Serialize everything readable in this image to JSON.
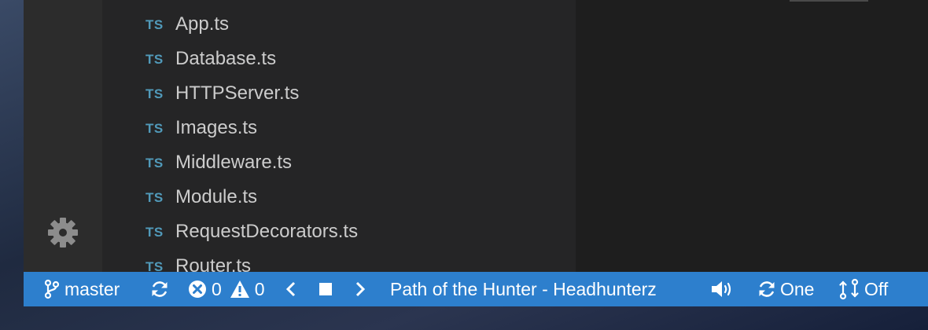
{
  "explorer": {
    "files": [
      {
        "badge": "TS",
        "name": "App.ts"
      },
      {
        "badge": "TS",
        "name": "Database.ts"
      },
      {
        "badge": "TS",
        "name": "HTTPServer.ts"
      },
      {
        "badge": "TS",
        "name": "Images.ts"
      },
      {
        "badge": "TS",
        "name": "Middleware.ts"
      },
      {
        "badge": "TS",
        "name": "Module.ts"
      },
      {
        "badge": "TS",
        "name": "RequestDecorators.ts"
      },
      {
        "badge": "TS",
        "name": "Router.ts"
      }
    ]
  },
  "activity_bar": {
    "bottom_icon": "gear-icon"
  },
  "status_bar": {
    "branch": "master",
    "errors": "0",
    "warnings": "0",
    "song": "Path of the Hunter - Headhunterz",
    "repeat": "One",
    "shuffle": "Off"
  },
  "colors": {
    "status_bar_bg": "#2d7fcd",
    "ts_badge": "#519aba",
    "sidebar_bg": "#252526",
    "activity_bar_bg": "#2c2c2c",
    "editor_bg": "#1e1e1e"
  }
}
